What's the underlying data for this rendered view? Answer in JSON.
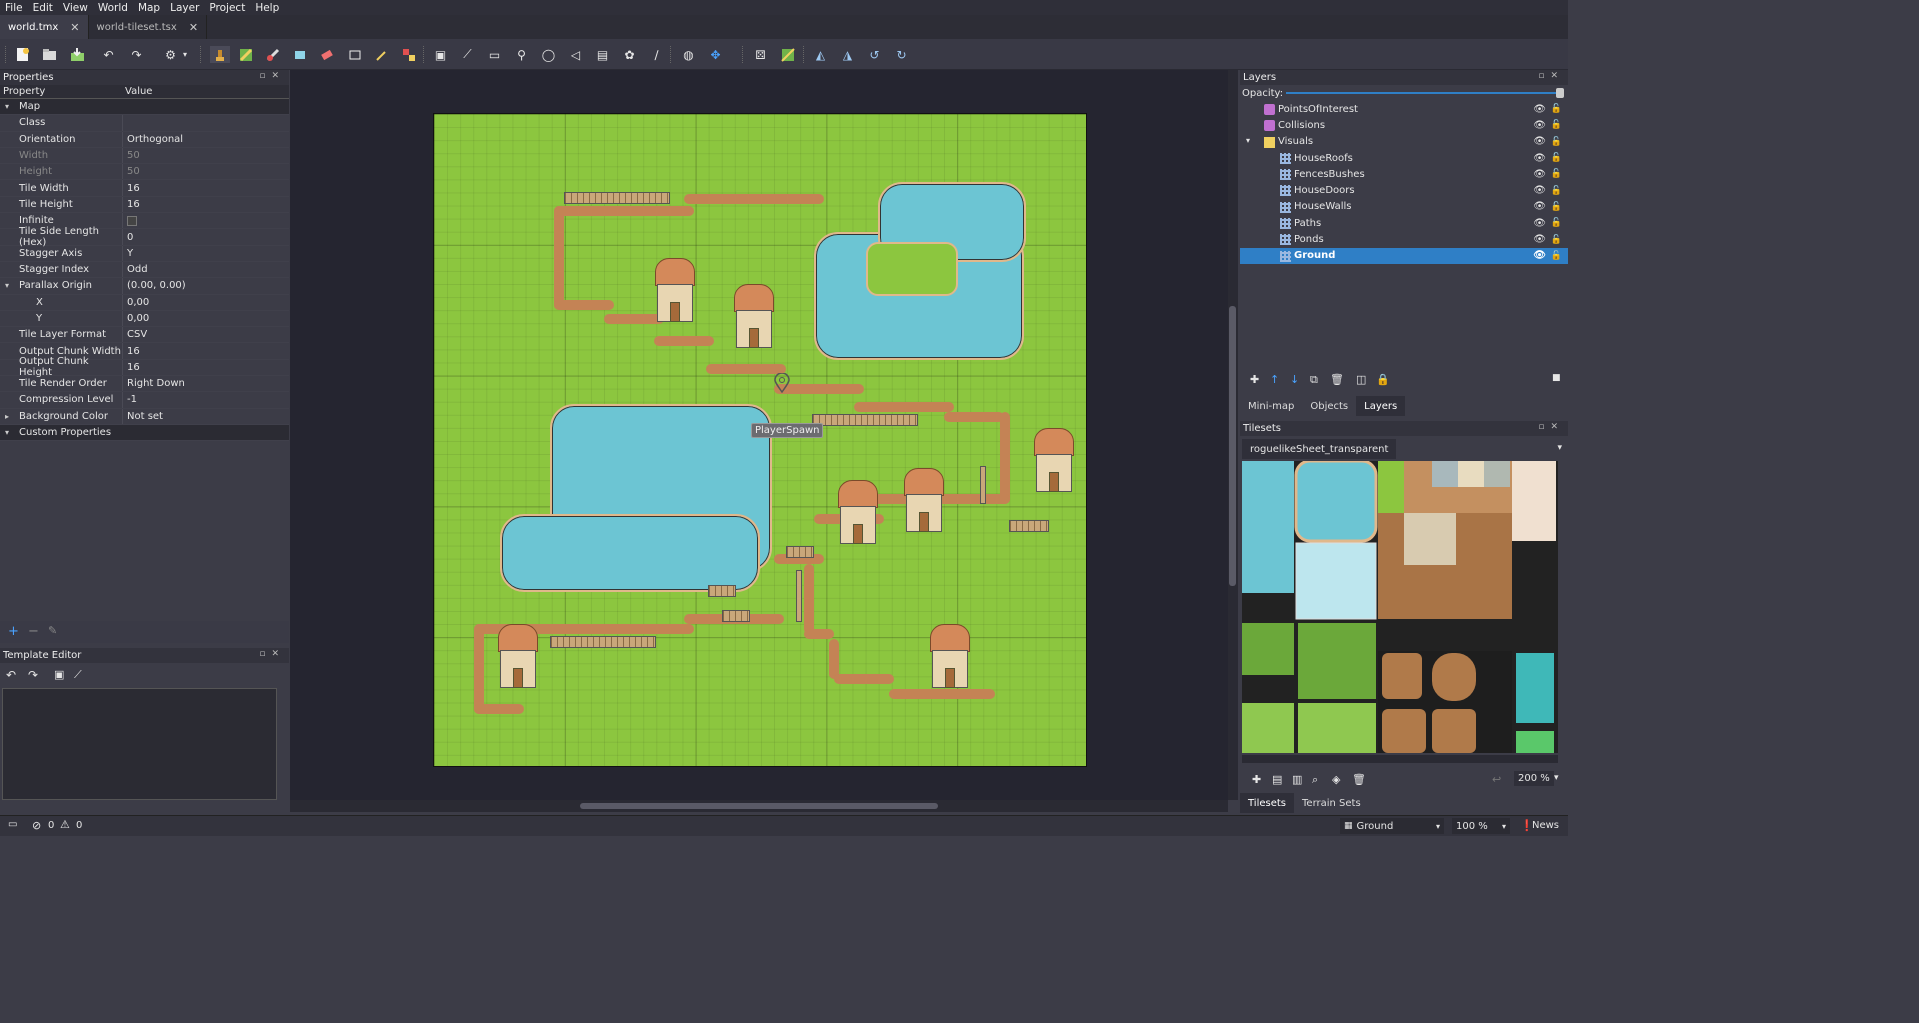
{
  "menu": [
    "File",
    "Edit",
    "View",
    "World",
    "Map",
    "Layer",
    "Project",
    "Help"
  ],
  "tabs": [
    {
      "label": "world.tmx",
      "close": "✕"
    },
    {
      "label": "world-tileset.tsx",
      "close": "✕"
    }
  ],
  "properties": {
    "title": "Properties",
    "col_property": "Property",
    "col_value": "Value",
    "rows": [
      {
        "k": "Map",
        "v": "",
        "group": true
      },
      {
        "k": "Class",
        "v": ""
      },
      {
        "k": "Orientation",
        "v": "Orthogonal"
      },
      {
        "k": "Width",
        "v": "50",
        "disabled": true
      },
      {
        "k": "Height",
        "v": "50",
        "disabled": true
      },
      {
        "k": "Tile Width",
        "v": "16"
      },
      {
        "k": "Tile Height",
        "v": "16"
      },
      {
        "k": "Infinite",
        "v": ""
      },
      {
        "k": "Tile Side Length (Hex)",
        "v": "0"
      },
      {
        "k": "Stagger Axis",
        "v": "Y"
      },
      {
        "k": "Stagger Index",
        "v": "Odd"
      },
      {
        "k": "Parallax Origin",
        "v": "(0.00, 0.00)"
      },
      {
        "k": "X",
        "v": "0,00"
      },
      {
        "k": "Y",
        "v": "0,00"
      },
      {
        "k": "Tile Layer Format",
        "v": "CSV"
      },
      {
        "k": "Output Chunk Width",
        "v": "16"
      },
      {
        "k": "Output Chunk Height",
        "v": "16"
      },
      {
        "k": "Tile Render Order",
        "v": "Right Down"
      },
      {
        "k": "Compression Level",
        "v": "-1"
      },
      {
        "k": "Background Color",
        "v": "Not set"
      },
      {
        "k": "Custom Properties",
        "v": "",
        "group": true
      }
    ]
  },
  "template_editor": {
    "title": "Template Editor"
  },
  "map": {
    "object_label": "PlayerSpawn"
  },
  "layers_panel": {
    "title": "Layers",
    "opacity_label": "Opacity:",
    "items": [
      {
        "name": "PointsOfInterest",
        "kind": "object-layer",
        "indent": 0
      },
      {
        "name": "Collisions",
        "kind": "object-layer",
        "indent": 0
      },
      {
        "name": "Visuals",
        "kind": "group-layer",
        "indent": 0
      },
      {
        "name": "HouseRoofs",
        "kind": "tile-layer",
        "indent": 1
      },
      {
        "name": "FencesBushes",
        "kind": "tile-layer",
        "indent": 1
      },
      {
        "name": "HouseDoors",
        "kind": "tile-layer",
        "indent": 1
      },
      {
        "name": "HouseWalls",
        "kind": "tile-layer",
        "indent": 1
      },
      {
        "name": "Paths",
        "kind": "tile-layer",
        "indent": 1
      },
      {
        "name": "Ponds",
        "kind": "tile-layer",
        "indent": 1
      },
      {
        "name": "Ground",
        "kind": "tile-layer",
        "indent": 1,
        "selected": true
      }
    ],
    "tabs": [
      "Mini-map",
      "Objects",
      "Layers"
    ]
  },
  "tilesets_panel": {
    "title": "Tilesets",
    "tab": "roguelikeSheet_transparent",
    "zoom": "200 %",
    "bottom_tabs": [
      "Tilesets",
      "Terrain Sets"
    ]
  },
  "status": {
    "errors": "0",
    "warnings": "0",
    "layer_select": "Ground",
    "zoom": "100 %",
    "news": "News"
  },
  "colors": {
    "accent": "#2f7fc6",
    "grass": "#8cc63f",
    "water": "#6cc5d3",
    "path": "#c48355"
  }
}
